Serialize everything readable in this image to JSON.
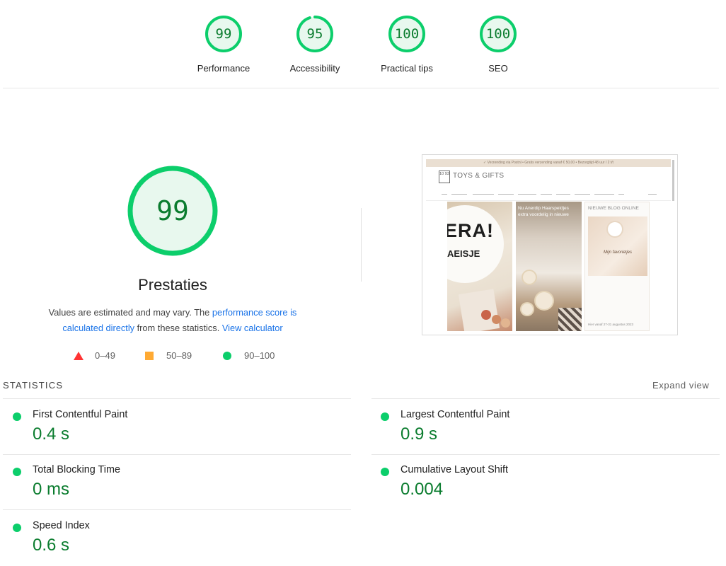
{
  "top_gauges": [
    {
      "score": "99",
      "label": "Performance",
      "fraction": 1.0
    },
    {
      "score": "95",
      "label": "Accessibility",
      "fraction": 0.95
    },
    {
      "score": "100",
      "label": "Practical tips",
      "fraction": 1.0
    },
    {
      "score": "100",
      "label": "SEO",
      "fraction": 1.0
    }
  ],
  "main_gauge": {
    "score": "99",
    "title": "Prestaties",
    "fraction": 1.0
  },
  "description": {
    "prefix": "Values are estimated and may vary. The ",
    "link1": "performance score is calculated directly",
    "middle": " from these statistics. ",
    "link2": "View calculator"
  },
  "legend": [
    {
      "range": "0–49",
      "shape": "triangle",
      "color": "#ff3333"
    },
    {
      "range": "50–89",
      "shape": "square",
      "color": "#ffaa33"
    },
    {
      "range": "90–100",
      "shape": "circle",
      "color": "#0cce6b"
    }
  ],
  "thumbnail": {
    "banner": "✓ Verzending via Postnl • Gratis verzending vanaf € 50,00 • Bezorgtijd 48 uur / 2 t/t",
    "logo_box": "10 93",
    "brand": "TOYS & GIFTS",
    "tile2_caption": "Nu Anerdip Haarspeldjes extra voordelig in nieuwe",
    "tile3_caption": "NIEUWE BLOG ONLINE",
    "tile1_big": "ERA!",
    "tile1_sub": "AEISJE",
    "tile3_image_text": "Mijn favorietjes",
    "tile3_date": "Hier vanaf 27-31 augustus 2023"
  },
  "statistics": {
    "heading": "STATISTICS",
    "expand_label": "Expand view",
    "metrics": [
      {
        "name": "First Contentful Paint",
        "value": "0.4 s"
      },
      {
        "name": "Largest Contentful Paint",
        "value": "0.9 s"
      },
      {
        "name": "Total Blocking Time",
        "value": "0 ms"
      },
      {
        "name": "Cumulative Layout Shift",
        "value": "0.004"
      },
      {
        "name": "Speed Index",
        "value": "0.6 s"
      }
    ]
  },
  "colors": {
    "pass": "#0cce6b",
    "pass_text": "#0a7c2e",
    "gauge_fill": "#e8f8ee",
    "link": "#1a73e8"
  }
}
